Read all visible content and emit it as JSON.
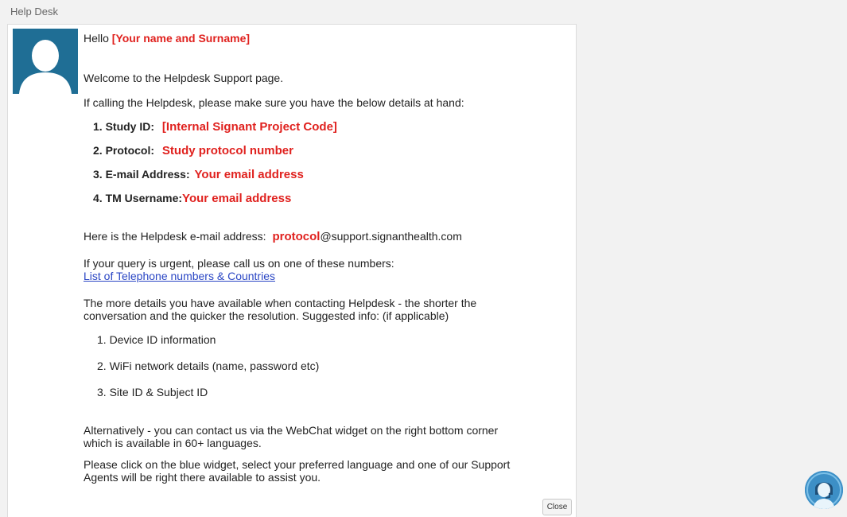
{
  "window": {
    "title": "Help Desk"
  },
  "greeting": {
    "hello": "Hello",
    "name_placeholder": "[Your name and Surname]"
  },
  "welcome": "Welcome to the Helpdesk Support page.",
  "calling_intro": "If calling the Helpdesk, please make sure you have the below details at hand:",
  "details": [
    {
      "label": "1. Study ID:",
      "value": "[Internal Signant Project Code]"
    },
    {
      "label": "2. Protocol:",
      "value": "Study protocol number"
    },
    {
      "label": "3. E-mail Address:",
      "value": "Your email address"
    },
    {
      "label": "4. TM Username:",
      "value": "Your email address"
    }
  ],
  "email": {
    "prefix": "Here is the Helpdesk e-mail address:",
    "protocol": "protocol",
    "domain": "@support.signanthealth.com"
  },
  "urgent": {
    "text": "If your query is urgent, please call us on one of these numbers:",
    "link": "List of Telephone numbers & Countries"
  },
  "more_details": {
    "line1": "The more details you have available when contacting Helpdesk - the shorter the",
    "line2": "conversation and the quicker the resolution. Suggested info: (if applicable)"
  },
  "suggested": [
    "1. Device ID information",
    "2. WiFi network details (name, password etc)",
    "3. Site ID & Subject ID"
  ],
  "alternative": {
    "line1": "Alternatively - you can contact us via the WebChat widget on the right bottom corner",
    "line2": "which is available in 60+ languages."
  },
  "click_info": {
    "line1": "Please click on the blue widget, select your preferred language and one of our Support",
    "line2": "Agents will be right there available to assist you."
  },
  "buttons": {
    "close": "Close"
  },
  "icons": {
    "avatar": "user-avatar-icon",
    "chat": "support-agent-chat-icon"
  },
  "colors": {
    "accent_red": "#e0211e",
    "link_blue": "#2a46c4",
    "avatar_bg": "#1f6e95",
    "widget_blue": "#3d8fc6"
  }
}
